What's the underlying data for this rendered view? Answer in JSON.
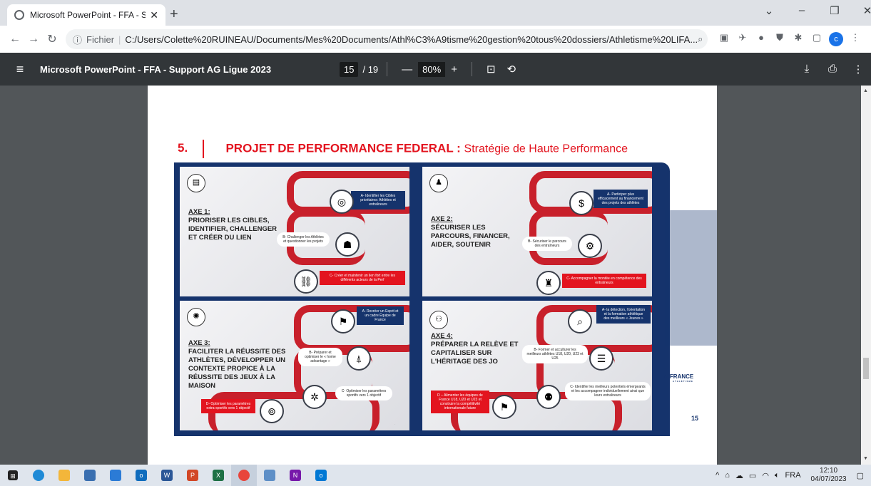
{
  "browser": {
    "tab_title": "Microsoft PowerPoint - FFA - Sup",
    "url_prefix": "Fichier",
    "url": "C:/Users/Colette%20RUINEAU/Documents/Mes%20Documents/Athl%C3%A9tisme%20gestion%20tous%20dossiers/Athletisme%20LIFA...",
    "profile_initial": "c"
  },
  "pdf": {
    "doc_title": "Microsoft PowerPoint - FFA - Support AG Ligue 2023",
    "page_current": "15",
    "page_total": "/ 19",
    "zoom": "80%"
  },
  "slide": {
    "number": "5.",
    "title": "PROJET DE PERFORMANCE FEDERAL :",
    "subtitle": "Stratégie de Haute Performance",
    "logo_text": "FRANCE",
    "logo_sub": "ATHLÉTISME",
    "slide_number": "15",
    "panels": [
      {
        "axe_label": "AXE 1:",
        "axe_text": "PRIORISER LES CIBLES, IDENTIFIER, CHALLENGER ET CRÉER DU LIEN",
        "step_a": "A- Identifier les Cibles prioritaires: Athlètes et entraîneurs",
        "step_b": "B- Challenger les Athlètes et questionner les projets",
        "step_c": "C- Créer et maintenir un lien fort entre les différents acteurs de la Perf"
      },
      {
        "axe_label": "AXE 2:",
        "axe_text": "SÉCURISER LES PARCOURS, FINANCER, AIDER, SOUTENIR",
        "step_a": "A- Participer plus efficacement au financement des projets des athlètes",
        "step_b": "B- Sécuriser le parcours des entraîneurs",
        "step_c": "C- Accompagner la montée en compétence des entraîneurs"
      },
      {
        "axe_label": "AXE 3:",
        "axe_text": "FACILITER LA RÉUSSITE DES ATHLÈTES, DÉVELOPPER UN CONTEXTE PROPICE À LA RÉUSSITE DES JEUX À LA MAISON",
        "step_a": "A- Recréer un Esprit et un cadre Équipe de France",
        "step_b": "B- Préparer et optimiser le « home advantage »",
        "step_c": "C- Optimiser les paramètres sportifs vers 1 objectif",
        "step_d": "D- Optimiser les paramètres extra-sportifs vers 1 objectif"
      },
      {
        "axe_label": "AXE 4:",
        "axe_text": "PRÉPARER LA RELÈVE ET CAPITALISER SUR L'HÉRITAGE DES JO",
        "step_a": "A- la détection, l'orientation et la formation athlétique des meilleurs « Jeunes »",
        "step_b": "B- Former et acculturer les meilleurs athlètes U18, U20, U23 et U25",
        "step_c": "C- Identifier les meilleurs potentiels émergeants et les accompagner individuellement ainsi que leurs entraîneurs",
        "step_d": "D – Alimenter les équipes de France U18, U20 et U23 et construire la compétitivité internationale future"
      }
    ]
  },
  "taskbar": {
    "lang": "FRA",
    "time": "12:10",
    "date": "04/07/2023"
  }
}
